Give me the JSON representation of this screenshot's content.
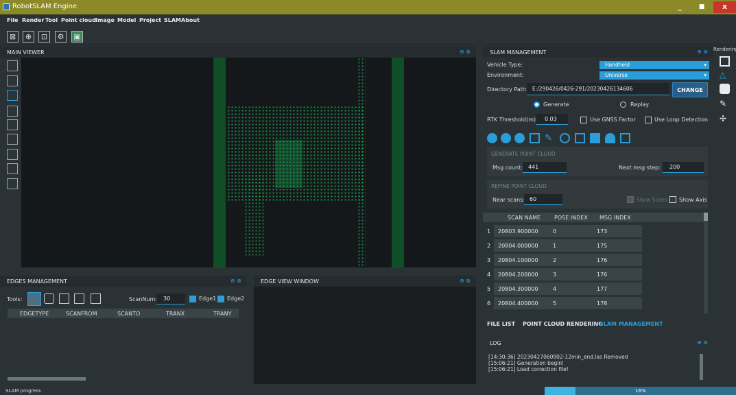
{
  "app": {
    "title": "RobotSLAM Engine"
  },
  "window_controls": {
    "minimize": "_",
    "maximize": "■",
    "close": "x"
  },
  "menu": [
    "File",
    "Render",
    "Tool",
    "Point cloud",
    "Image",
    "Model",
    "Project",
    "SLAM",
    "About"
  ],
  "main_viewer": {
    "title": "MAIN VIEWER"
  },
  "edges": {
    "title": "EDGES MANAGEMENT",
    "tools_label": "Tools:",
    "scannum_label": "ScanNum:",
    "scannum": "30",
    "edge1": "Edge1",
    "edge2": "Edge2",
    "columns": [
      "EDGETYPE",
      "SCANFROM",
      "SCANTO",
      "TRANX",
      "TRANY"
    ]
  },
  "edge_view": {
    "title": "EDGE VIEW WINDOW"
  },
  "slam": {
    "title": "SLAM MANAGEMENT",
    "vehicle_label": "Vehicle Type:",
    "vehicle": "Handheld",
    "env_label": "Environment:",
    "env": "Universe",
    "dir_label": "Directory Path:",
    "dir": "E:/290426/0426-291/20230426134606",
    "change": "CHANGE",
    "generate": "Generate",
    "replay": "Replay",
    "rtk_label": "RTK Threshold(m):",
    "rtk": "0.03",
    "gnss": "Use GNSS Factor",
    "loop": "Use Loop Detection",
    "gen_title": "GENERATE POINT CLOUD",
    "msg_count_label": "Msg count:",
    "msg_count": "441",
    "next_step_label": "Next msg step:",
    "next_step": "200",
    "refine_title": "REFINE POINT CLOUD",
    "near_scans_label": "Near scans:",
    "near_scans": "60",
    "show_scans": "Show Scans",
    "show_axis": "Show Axis",
    "columns": [
      "SCAN NAME",
      "POSE INDEX",
      "MSG INDEX"
    ],
    "rows": [
      {
        "n": "1",
        "scan": "20803.900000",
        "pose": "0",
        "msg": "173"
      },
      {
        "n": "2",
        "scan": "20804.000000",
        "pose": "1",
        "msg": "175"
      },
      {
        "n": "3",
        "scan": "20804.100000",
        "pose": "2",
        "msg": "176"
      },
      {
        "n": "4",
        "scan": "20804.200000",
        "pose": "3",
        "msg": "176"
      },
      {
        "n": "5",
        "scan": "20804.300000",
        "pose": "4",
        "msg": "177"
      },
      {
        "n": "6",
        "scan": "20804.400000",
        "pose": "5",
        "msg": "178"
      }
    ]
  },
  "tabs": [
    "FILE LIST",
    "POINT CLOUD RENDERING",
    "SLAM MANAGEMENT"
  ],
  "log": {
    "title": "LOG",
    "lines": [
      "[14:30:36] 20230427060902-12min_end.las Removed",
      "[15:06:21] Generation begin!",
      "[15:06:21] Load correction file!"
    ]
  },
  "rendering": {
    "title": "Rendering"
  },
  "status": {
    "label": "SLAM progress",
    "percent": "16%",
    "progress": 0.16
  }
}
